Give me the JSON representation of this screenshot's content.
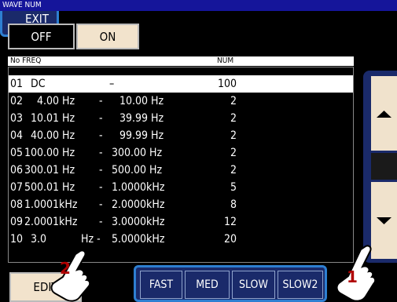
{
  "title": "WAVE NUM",
  "toggle": {
    "off_label": "OFF",
    "on_label": "ON"
  },
  "table": {
    "headers": {
      "no_freq": "No FREQ",
      "num": "NUM"
    },
    "rows": [
      {
        "no": "01",
        "freq": "DC",
        "sep": "–",
        "to": "",
        "num": "100"
      },
      {
        "no": "02",
        "freq": "4.00 Hz",
        "sep": "-",
        "to": "10.00 Hz",
        "num": "2"
      },
      {
        "no": "03",
        "freq": "10.01 Hz",
        "sep": "-",
        "to": "39.99 Hz",
        "num": "2"
      },
      {
        "no": "04",
        "freq": "40.00 Hz",
        "sep": "-",
        "to": "99.99 Hz",
        "num": "2"
      },
      {
        "no": "05",
        "freq": "100.00 Hz",
        "sep": "-",
        "to": "300.00 Hz",
        "num": "2"
      },
      {
        "no": "06",
        "freq": "300.01 Hz",
        "sep": "-",
        "to": "500.00 Hz",
        "num": "2"
      },
      {
        "no": "07",
        "freq": "500.01 Hz",
        "sep": "-",
        "to": "1.0000kHz",
        "num": "5"
      },
      {
        "no": "08",
        "freq": "1.0001kHz",
        "sep": "-",
        "to": "2.0000kHz",
        "num": "8"
      },
      {
        "no": "09",
        "freq": "2.0001kHz",
        "sep": "-",
        "to": "3.0000kHz",
        "num": "12"
      },
      {
        "no": "10",
        "freq": "3.0",
        "sep": "Hz -",
        "to": "5.0000kHz",
        "num": "20"
      }
    ]
  },
  "buttons": {
    "edit": "EDIT",
    "fast": "FAST",
    "med": "MED",
    "slow": "SLOW",
    "slow2": "SLOW2",
    "exit": "EXIT"
  },
  "callouts": {
    "one": "1",
    "two": "2"
  },
  "colors": {
    "title_bar": "#15159a",
    "button_face": "#f2e3cc",
    "panel_blue": "#1a2a6a",
    "accent_blue": "#2e7fd1",
    "callout_red": "#b00000"
  }
}
